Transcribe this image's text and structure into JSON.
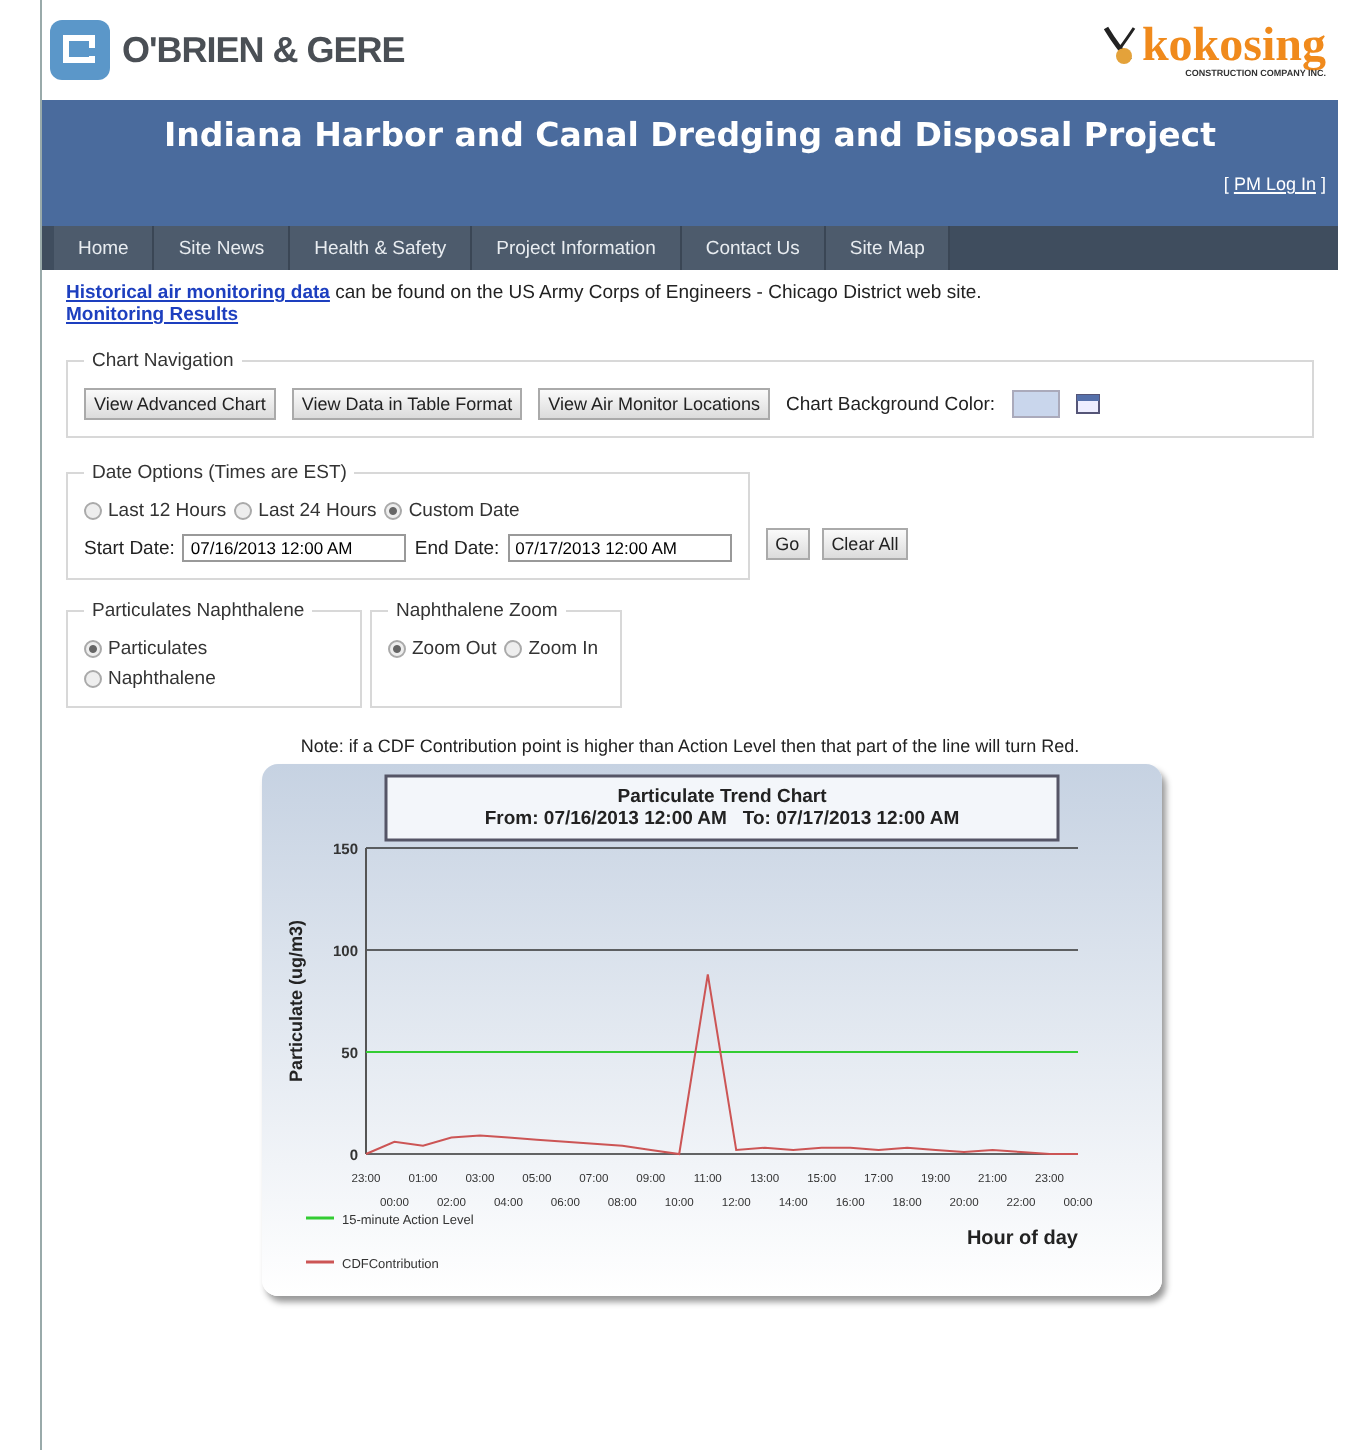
{
  "header": {
    "logo_left": "O'BRIEN & GERE",
    "logo_right": "kokosing",
    "logo_right_sub": "CONSTRUCTION COMPANY INC.",
    "title": "Indiana Harbor and Canal Dredging and Disposal Project",
    "login_open": "[",
    "login_link": "PM Log In",
    "login_close": "]"
  },
  "nav": [
    {
      "label": "Home",
      "selected": false
    },
    {
      "label": "Site News",
      "selected": false
    },
    {
      "label": "Health & Safety",
      "selected": false
    },
    {
      "label": "Project Information",
      "selected": false
    },
    {
      "label": "Contact Us",
      "selected": false
    },
    {
      "label": "Site Map",
      "selected": false
    }
  ],
  "intro": {
    "link": "Historical air monitoring data",
    "text": " can be found on the US Army Corps of Engineers - Chicago District web site.",
    "results_link": "Monitoring Results"
  },
  "chart_navigation": {
    "legend": "Chart Navigation",
    "buttons": [
      "View Advanced Chart",
      "View Data in Table Format",
      "View Air Monitor Locations"
    ],
    "color_label": "Chart Background Color:"
  },
  "date_options": {
    "legend": "Date Options (Times are EST)",
    "radios": [
      {
        "label": "Last 12 Hours",
        "selected": false
      },
      {
        "label": "Last 24 Hours",
        "selected": false
      },
      {
        "label": "Custom Date",
        "selected": true
      }
    ],
    "start_label": "Start Date:",
    "start_value": "07/16/2013 12:00 AM",
    "end_label": "End Date:",
    "end_value": "07/17/2013 12:00 AM",
    "buttons": [
      "Go",
      "Clear All"
    ]
  },
  "particulates": {
    "legend": "Particulates Naphthalene",
    "radios": [
      {
        "label": "Particulates",
        "selected": true
      },
      {
        "label": "Naphthalene",
        "selected": false
      }
    ]
  },
  "zoom": {
    "legend": "Naphthalene Zoom",
    "radios": [
      {
        "label": "Zoom Out",
        "selected": true
      },
      {
        "label": "Zoom In",
        "selected": false
      }
    ]
  },
  "note": "Note: if a CDF Contribution point is higher than Action Level then that part of the line will turn Red.",
  "chart": {
    "chart_data": {
      "type": "line",
      "title": "Particulate Trend Chart\nFrom: 07/16/2013 12:00 AM   To: 07/17/2013 12:00 AM",
      "xlabel": "Hour of day",
      "ylabel": "Particulate (ug/m3)",
      "categories": [
        "23:00",
        "00:00",
        "01:00",
        "02:00",
        "03:00",
        "04:00",
        "05:00",
        "06:00",
        "07:00",
        "08:00",
        "09:00",
        "10:00",
        "11:00",
        "12:00",
        "13:00",
        "14:00",
        "15:00",
        "16:00",
        "17:00",
        "18:00",
        "19:00",
        "20:00",
        "21:00",
        "22:00",
        "23:00",
        "00:00"
      ],
      "series": [
        {
          "name": "15-minute Action Level",
          "color": "#33cc33",
          "values": [
            50,
            50,
            50,
            50,
            50,
            50,
            50,
            50,
            50,
            50,
            50,
            50,
            50,
            50,
            50,
            50,
            50,
            50,
            50,
            50,
            50,
            50,
            50,
            50,
            50,
            50
          ]
        },
        {
          "name": "CDFContribution",
          "color": "#cc5555",
          "values": [
            0,
            6,
            4,
            8,
            9,
            8,
            7,
            6,
            5,
            4,
            2,
            0,
            88,
            2,
            3,
            2,
            3,
            3,
            2,
            3,
            2,
            1,
            2,
            1,
            0,
            0
          ]
        }
      ],
      "ylim": [
        0,
        150
      ],
      "yticks": [
        0,
        50,
        100,
        150
      ],
      "legend": true
    }
  }
}
